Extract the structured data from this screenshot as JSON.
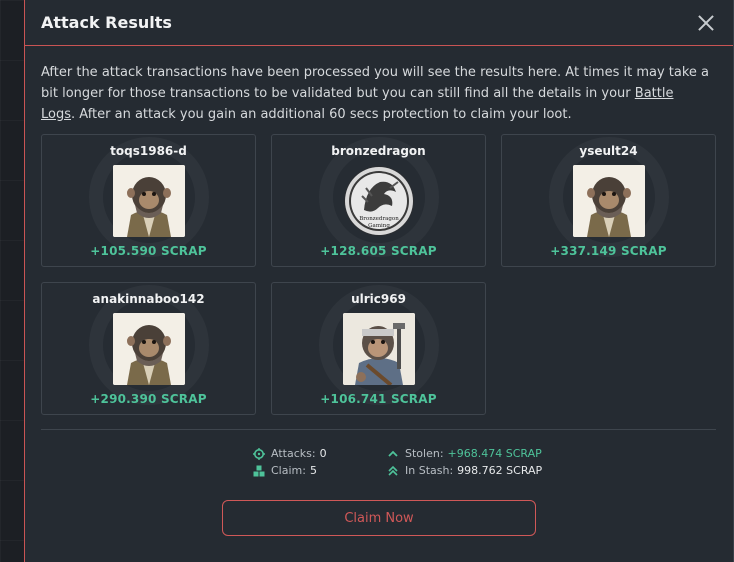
{
  "modal": {
    "title": "Attack Results",
    "intro_before_link": "After the attack transactions have been processed you will see the results here. At times it may take a bit longer for those transactions to be validated but you can still find all the details in your ",
    "link_text": "Battle Logs",
    "intro_after_link": ". After an attack you gain an additional 60 secs protection to claim your loot."
  },
  "results": [
    {
      "name": "toqs1986-d",
      "gain": "+105.590 SCRAP",
      "avatar": "monkey-scout"
    },
    {
      "name": "bronzedragon",
      "gain": "+128.605 SCRAP",
      "avatar": "bronzedragon-gaming-logo",
      "logo_text": "Bronzedragon Gaming"
    },
    {
      "name": "yseult24",
      "gain": "+337.149 SCRAP",
      "avatar": "monkey-scout"
    },
    {
      "name": "anakinnaboo142",
      "gain": "+290.390 SCRAP",
      "avatar": "monkey-scout"
    },
    {
      "name": "ulric969",
      "gain": "+106.741 SCRAP",
      "avatar": "monkey-headband"
    }
  ],
  "stats": {
    "attacks_label": "Attacks:",
    "attacks_value": "0",
    "claim_label": "Claim:",
    "claim_value": "5",
    "stolen_label": "Stolen:",
    "stolen_value": "+968.474 SCRAP",
    "stash_label": "In Stash:",
    "stash_value": "998.762 SCRAP"
  },
  "claim_button": "Claim Now",
  "colors": {
    "accent": "#d05858",
    "gain": "#4ec39a",
    "panel": "#252b32"
  }
}
